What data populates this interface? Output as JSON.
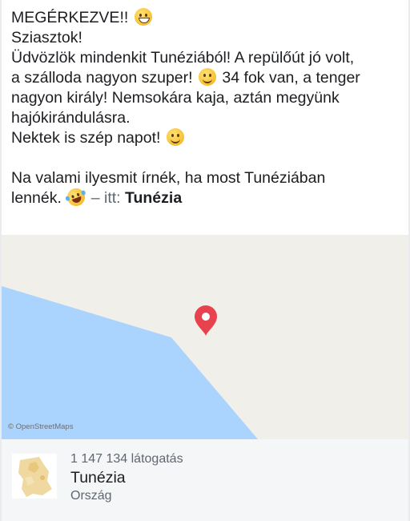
{
  "post": {
    "line1": "MEGÉRKEZVE!!",
    "line2": "Sziasztok!",
    "line3": "Üdvözlök mindenkit Tunéziából! A repülőút jó volt,",
    "line4a": "a szálloda nagyon szuper!",
    "line4b": "34 fok van, a tenger",
    "line5": "nagyon király! Nemsokára kaja, aztán megyünk",
    "line6": "hajókirándulásra.",
    "line7": "Nektek is szép napot!",
    "line9": "Na valami ilyesmit írnék, ha most Tunéziában",
    "line10": "lennék.",
    "itt": "– itt:",
    "place_link": "Tunézia"
  },
  "map": {
    "attribution": "© OpenStreetMaps",
    "land_color": "#f1efe9",
    "water_color": "#aad3fd",
    "pin_color": "#e8424f",
    "pin_icon": "map-pin-icon"
  },
  "place": {
    "visits": "1 147 134 látogatás",
    "name": "Tunézia",
    "type": "Ország"
  },
  "emojis": {
    "grin": "grinning-face-icon",
    "smile": "smiling-face-icon",
    "laugh": "rolling-laughing-face-icon"
  }
}
